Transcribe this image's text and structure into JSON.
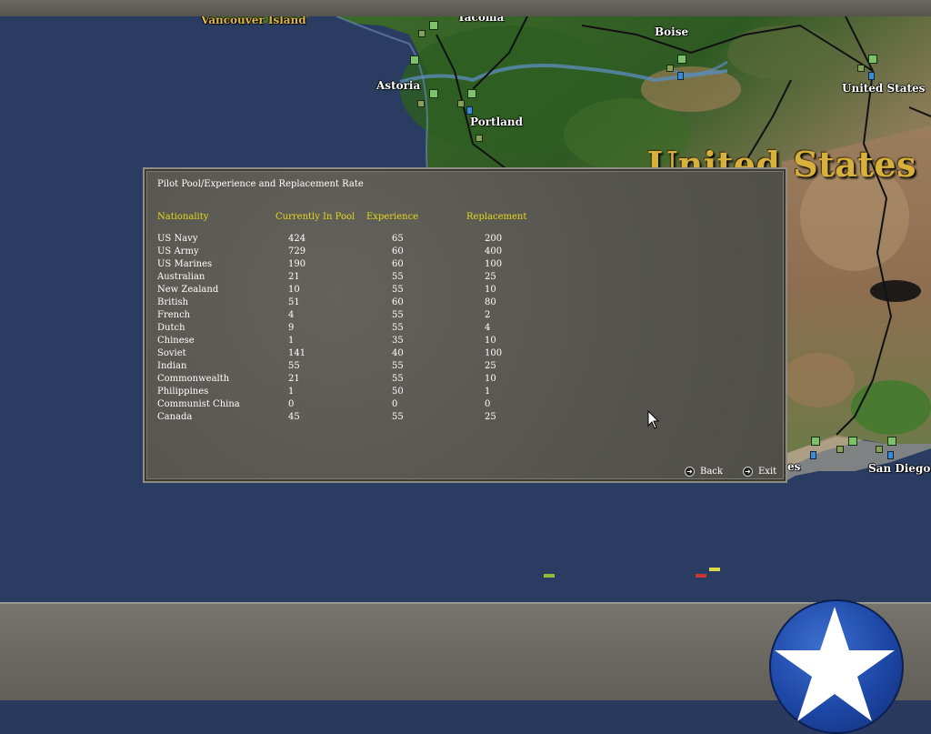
{
  "map": {
    "labels": {
      "vancouver": "Vancouver Island",
      "tacoma": "Tacoma",
      "boise": "Boise",
      "astoria": "Astoria",
      "portland": "Portland",
      "united_states_small": "United States",
      "united_states_big": "United States",
      "san_diego": "San Diego",
      "los_angeles_fragment": "es"
    }
  },
  "dialog": {
    "title": "Pilot Pool/Experience and Replacement Rate",
    "headers": {
      "nationality": "Nationality",
      "pool": "Currently In Pool",
      "experience": "Experience",
      "replacement": "Replacement"
    },
    "rows": [
      {
        "nationality": "US Navy",
        "pool": "424",
        "experience": "65",
        "replacement": "200"
      },
      {
        "nationality": "US Army",
        "pool": "729",
        "experience": "60",
        "replacement": "400"
      },
      {
        "nationality": "US Marines",
        "pool": "190",
        "experience": "60",
        "replacement": "100"
      },
      {
        "nationality": "Australian",
        "pool": "21",
        "experience": "55",
        "replacement": "25"
      },
      {
        "nationality": "New Zealand",
        "pool": "10",
        "experience": "55",
        "replacement": "10"
      },
      {
        "nationality": "British",
        "pool": "51",
        "experience": "60",
        "replacement": "80"
      },
      {
        "nationality": "French",
        "pool": "4",
        "experience": "55",
        "replacement": "2"
      },
      {
        "nationality": "Dutch",
        "pool": "9",
        "experience": "55",
        "replacement": "4"
      },
      {
        "nationality": "Chinese",
        "pool": "1",
        "experience": "35",
        "replacement": "10"
      },
      {
        "nationality": "Soviet",
        "pool": "141",
        "experience": "40",
        "replacement": "100"
      },
      {
        "nationality": "Indian",
        "pool": "55",
        "experience": "55",
        "replacement": "25"
      },
      {
        "nationality": "Commonwealth",
        "pool": "21",
        "experience": "55",
        "replacement": "10"
      },
      {
        "nationality": "Philippines",
        "pool": "1",
        "experience": "50",
        "replacement": "1"
      },
      {
        "nationality": "Communist China",
        "pool": "0",
        "experience": "0",
        "replacement": "0"
      },
      {
        "nationality": "Canada",
        "pool": "45",
        "experience": "55",
        "replacement": "25"
      }
    ],
    "buttons": {
      "back": "Back",
      "exit": "Exit"
    }
  },
  "icons": [
    "arrow-right-icon",
    "star-emblem-icon",
    "mouse-cursor-icon"
  ],
  "colors": {
    "header_yellow": "#e6d81a",
    "ocean": "#2b3c62",
    "panel": "#5a5953",
    "emblem_blue": "#1d47a6"
  }
}
